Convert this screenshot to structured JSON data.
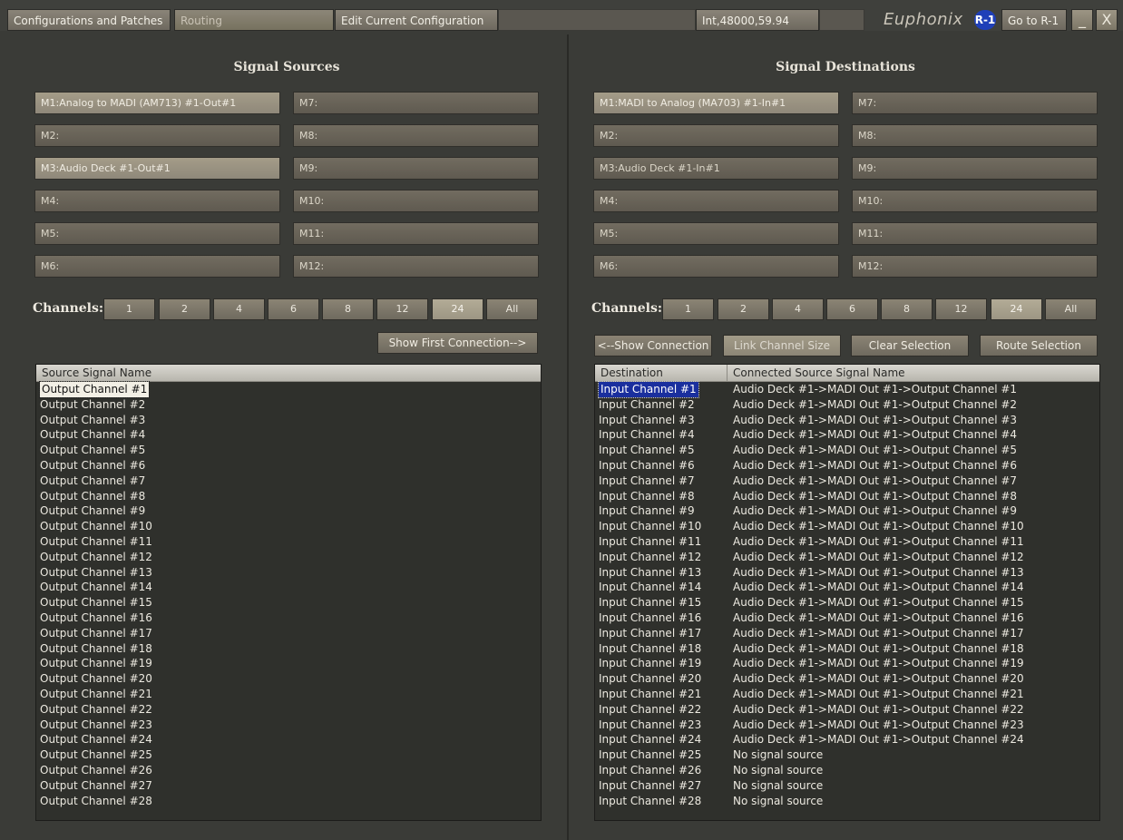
{
  "toolbar": {
    "configurations_label": "Configurations and Patches",
    "routing_label": "Routing",
    "edit_config_label": "Edit Current Configuration",
    "status_text": "Int,48000,59.94",
    "brand": "Euphonix",
    "brand_badge": "R-1",
    "goto_label": "Go to R-1",
    "close_label": "X"
  },
  "sources": {
    "title": "Signal Sources",
    "slots_left": [
      "M1:Analog to MADI (AM713) #1-Out#1",
      "M2:",
      "M3:Audio Deck #1-Out#1",
      "M4:",
      "M5:",
      "M6:"
    ],
    "slots_right": [
      "M7:",
      "M8:",
      "M9:",
      "M10:",
      "M11:",
      "M12:"
    ],
    "channels_label": "Channels:",
    "channel_buttons": [
      "1",
      "2",
      "4",
      "6",
      "8",
      "12",
      "24",
      "All"
    ],
    "channel_selected": "24",
    "show_first_label": "Show First Connection-->",
    "list_header": "Source Signal Name",
    "rows": [
      "Output Channel #1",
      "Output Channel #2",
      "Output Channel #3",
      "Output Channel #4",
      "Output Channel #5",
      "Output Channel #6",
      "Output Channel #7",
      "Output Channel #8",
      "Output Channel #9",
      "Output Channel #10",
      "Output Channel #11",
      "Output Channel #12",
      "Output Channel #13",
      "Output Channel #14",
      "Output Channel #15",
      "Output Channel #16",
      "Output Channel #17",
      "Output Channel #18",
      "Output Channel #19",
      "Output Channel #20",
      "Output Channel #21",
      "Output Channel #22",
      "Output Channel #23",
      "Output Channel #24",
      "Output Channel #25",
      "Output Channel #26",
      "Output Channel #27",
      "Output Channel #28"
    ]
  },
  "destinations": {
    "title": "Signal Destinations",
    "slots_left": [
      "M1:MADI to Analog (MA703) #1-In#1",
      "M2:",
      "M3:Audio Deck #1-In#1",
      "M4:",
      "M5:",
      "M6:"
    ],
    "slots_right": [
      "M7:",
      "M8:",
      "M9:",
      "M10:",
      "M11:",
      "M12:"
    ],
    "channels_label": "Channels:",
    "channel_buttons": [
      "1",
      "2",
      "4",
      "6",
      "8",
      "12",
      "24",
      "All"
    ],
    "channel_selected": "24",
    "show_connection_label": "<--Show Connection",
    "link_size_label": "Link Channel Size",
    "clear_label": "Clear Selection",
    "route_label": "Route Selection",
    "header_dest": "Destination",
    "header_src": "Connected Source Signal Name",
    "rows": [
      [
        "Input Channel #1",
        "Audio Deck #1->MADI Out #1->Output Channel #1"
      ],
      [
        "Input Channel #2",
        "Audio Deck #1->MADI Out #1->Output Channel #2"
      ],
      [
        "Input Channel #3",
        "Audio Deck #1->MADI Out #1->Output Channel #3"
      ],
      [
        "Input Channel #4",
        "Audio Deck #1->MADI Out #1->Output Channel #4"
      ],
      [
        "Input Channel #5",
        "Audio Deck #1->MADI Out #1->Output Channel #5"
      ],
      [
        "Input Channel #6",
        "Audio Deck #1->MADI Out #1->Output Channel #6"
      ],
      [
        "Input Channel #7",
        "Audio Deck #1->MADI Out #1->Output Channel #7"
      ],
      [
        "Input Channel #8",
        "Audio Deck #1->MADI Out #1->Output Channel #8"
      ],
      [
        "Input Channel #9",
        "Audio Deck #1->MADI Out #1->Output Channel #9"
      ],
      [
        "Input Channel #10",
        "Audio Deck #1->MADI Out #1->Output Channel #10"
      ],
      [
        "Input Channel #11",
        "Audio Deck #1->MADI Out #1->Output Channel #11"
      ],
      [
        "Input Channel #12",
        "Audio Deck #1->MADI Out #1->Output Channel #12"
      ],
      [
        "Input Channel #13",
        "Audio Deck #1->MADI Out #1->Output Channel #13"
      ],
      [
        "Input Channel #14",
        "Audio Deck #1->MADI Out #1->Output Channel #14"
      ],
      [
        "Input Channel #15",
        "Audio Deck #1->MADI Out #1->Output Channel #15"
      ],
      [
        "Input Channel #16",
        "Audio Deck #1->MADI Out #1->Output Channel #16"
      ],
      [
        "Input Channel #17",
        "Audio Deck #1->MADI Out #1->Output Channel #17"
      ],
      [
        "Input Channel #18",
        "Audio Deck #1->MADI Out #1->Output Channel #18"
      ],
      [
        "Input Channel #19",
        "Audio Deck #1->MADI Out #1->Output Channel #19"
      ],
      [
        "Input Channel #20",
        "Audio Deck #1->MADI Out #1->Output Channel #20"
      ],
      [
        "Input Channel #21",
        "Audio Deck #1->MADI Out #1->Output Channel #21"
      ],
      [
        "Input Channel #22",
        "Audio Deck #1->MADI Out #1->Output Channel #22"
      ],
      [
        "Input Channel #23",
        "Audio Deck #1->MADI Out #1->Output Channel #23"
      ],
      [
        "Input Channel #24",
        "Audio Deck #1->MADI Out #1->Output Channel #24"
      ],
      [
        "Input Channel #25",
        "No signal source"
      ],
      [
        "Input Channel #26",
        "No signal source"
      ],
      [
        "Input Channel #27",
        "No signal source"
      ],
      [
        "Input Channel #28",
        "No signal source"
      ]
    ]
  }
}
